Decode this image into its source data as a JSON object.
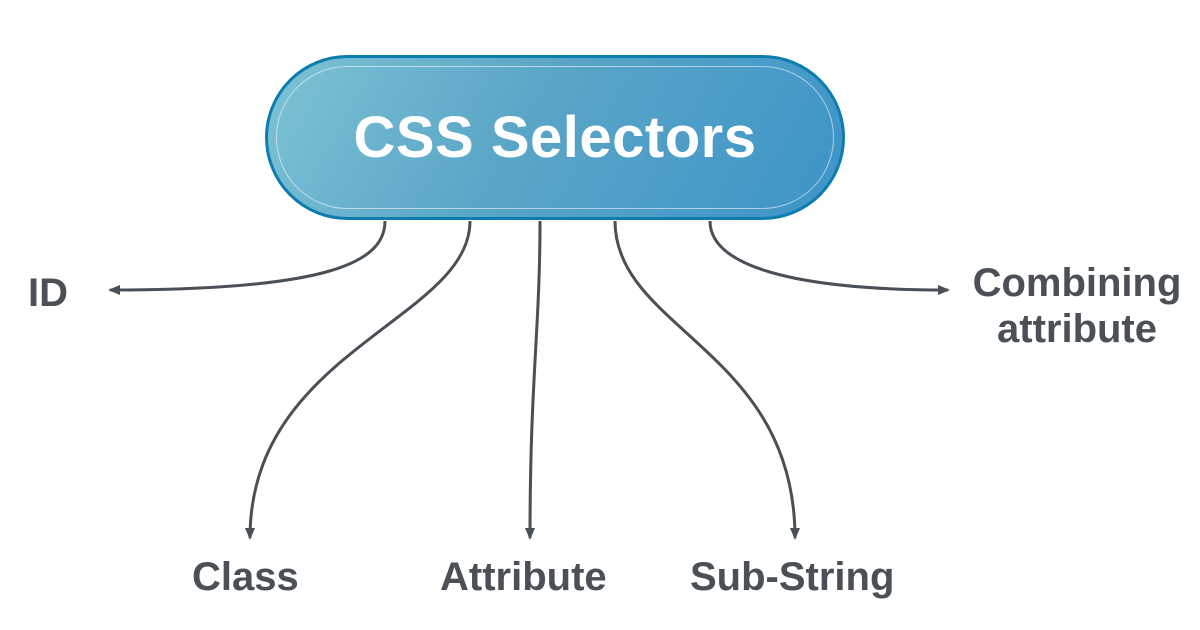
{
  "diagram": {
    "root": "CSS Selectors",
    "branches": {
      "id": "ID",
      "class": "Class",
      "attribute": "Attribute",
      "substring": "Sub-String",
      "combining_line1": "Combining",
      "combining_line2": "attribute"
    }
  },
  "colors": {
    "pill_gradient_start": "#7dc3d5",
    "pill_gradient_end": "#3d94c8",
    "pill_border": "#0d7caf",
    "arrow": "#4a5055",
    "label": "#4a5055"
  }
}
